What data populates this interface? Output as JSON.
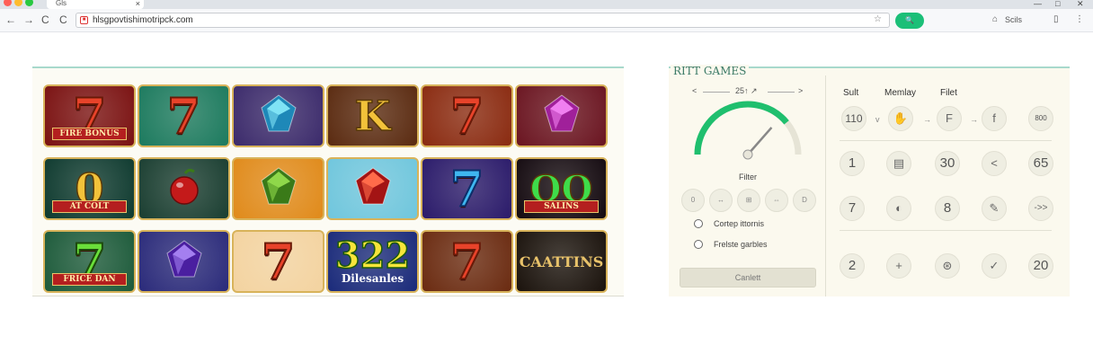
{
  "browser": {
    "tab_title": "Gls",
    "tab_close": "×",
    "url": "hlsgpovtishimotripck.com",
    "nav": {
      "back": "←",
      "forward": "→",
      "reload": "C",
      "reload2": "C"
    },
    "bookmark_star": "☆",
    "go_icon": "🔍",
    "account_label": "Scils",
    "window": {
      "minimize": "—",
      "maximize": "□",
      "close": "✕"
    },
    "dot_colors": [
      "#ff5f57",
      "#febc2e",
      "#28c840"
    ]
  },
  "game_grid": {
    "tiles": [
      {
        "type": "seven",
        "bg": "#7a1111",
        "ribbon": "FIRE BONUS"
      },
      {
        "type": "seven",
        "bg": "#1c7a5e",
        "ribbon": ""
      },
      {
        "type": "gem-blue",
        "bg": "#3b2a6b",
        "ribbon": ""
      },
      {
        "type": "letter",
        "bg": "#5a2a10",
        "text": "K",
        "ribbon": ""
      },
      {
        "type": "seven",
        "bg": "#8a2a10",
        "ribbon": ""
      },
      {
        "type": "gem-pink",
        "bg": "#6a1420",
        "ribbon": ""
      },
      {
        "type": "letter",
        "bg": "#0e3a2f",
        "text": "0",
        "ribbon": "AT COLT"
      },
      {
        "type": "cherry",
        "bg": "#1a3e31",
        "ribbon": ""
      },
      {
        "type": "gem-green",
        "bg": "#e08a1a",
        "ribbon": ""
      },
      {
        "type": "gem-red",
        "bg": "#6fc6dd",
        "ribbon": ""
      },
      {
        "type": "seven-blue",
        "bg": "#2a1a6a",
        "ribbon": ""
      },
      {
        "type": "letter",
        "bg": "#140a10",
        "text": "QQ",
        "ribbon": "SALINS"
      },
      {
        "type": "seven-green",
        "bg": "#1c5a3a",
        "ribbon": "FRICE DAN"
      },
      {
        "type": "gem-purple",
        "bg": "#2a2a7a",
        "ribbon": ""
      },
      {
        "type": "seven",
        "bg": "#f3d3a0",
        "ribbon": ""
      },
      {
        "type": "number",
        "bg": "#1a2a7a",
        "text": "322",
        "ribbon": "Dilesanles"
      },
      {
        "type": "seven",
        "bg": "#6a2a10",
        "ribbon": ""
      },
      {
        "type": "caption",
        "bg": "#1a120c",
        "text": "CAATTINS",
        "ribbon": ""
      }
    ]
  },
  "filter_panel": {
    "title": "RITT GAMES",
    "pager": {
      "prev": "<",
      "label": "25↑ ↗",
      "next": ">"
    },
    "gauge_value": 0.78,
    "filter_label": "Filter",
    "pills": [
      "0",
      "↔",
      "⊞",
      "⇔",
      "D"
    ],
    "radios": [
      "Cortep ittornis",
      "Frelste garbles"
    ],
    "apply_label": "Canlett"
  },
  "sort_panel": {
    "headers": [
      "Sult",
      "Memlay",
      "Filet"
    ],
    "row1": {
      "items": [
        "110",
        "✋",
        "F",
        "f",
        "800"
      ],
      "arrows": [
        "v",
        "→",
        "→"
      ]
    },
    "row2": [
      "1",
      "▤",
      "30",
      "<",
      "65"
    ],
    "row3": [
      "7",
      "◐",
      "8",
      "✎",
      "->>"
    ],
    "row4": [
      "2",
      "+",
      "⊛",
      "✓",
      "20"
    ]
  }
}
